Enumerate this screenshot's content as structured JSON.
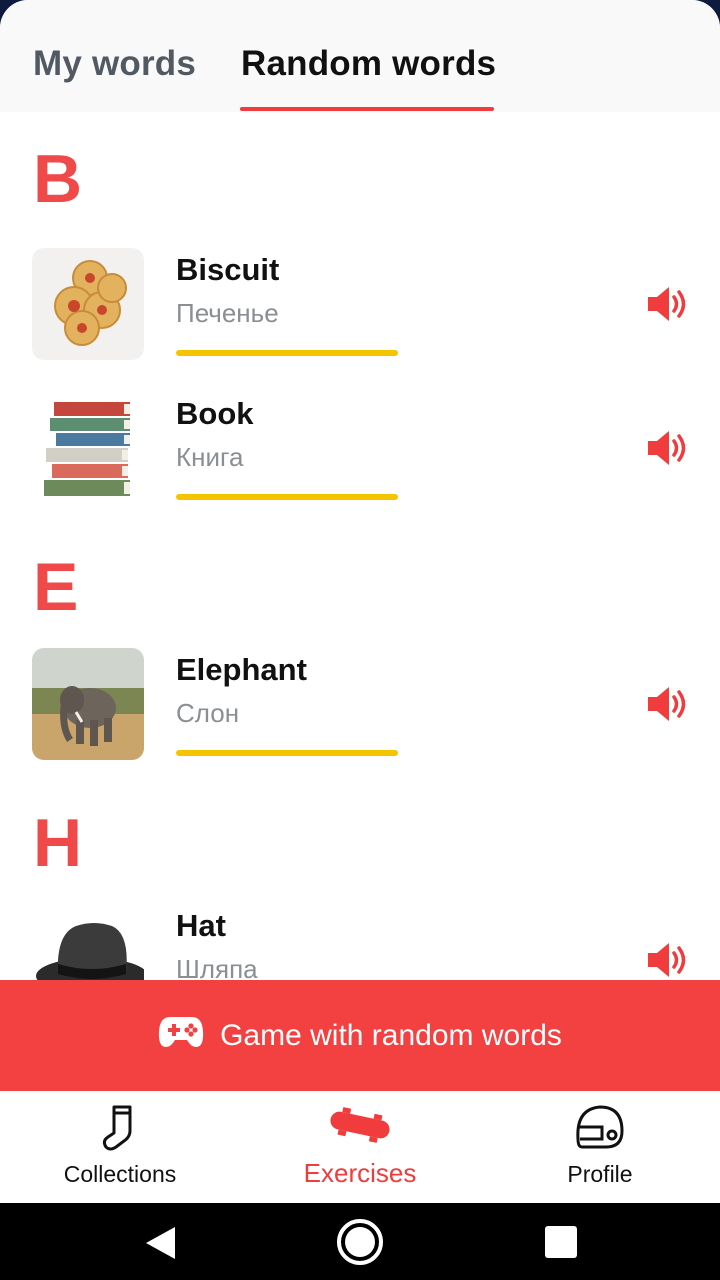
{
  "tabs": {
    "my_words": "My words",
    "random_words": "Random words"
  },
  "sections": [
    {
      "letter": "B",
      "words": [
        {
          "en": "Biscuit",
          "ru": "Печенье",
          "progress": 1.0,
          "image": "biscuit-photo"
        },
        {
          "en": "Book",
          "ru": "Книга",
          "progress": 1.0,
          "image": "books-photo"
        }
      ]
    },
    {
      "letter": "E",
      "words": [
        {
          "en": "Elephant",
          "ru": "Слон",
          "progress": 1.0,
          "image": "elephant-photo"
        }
      ]
    },
    {
      "letter": "H",
      "words": [
        {
          "en": "Hat",
          "ru": "Шляпа",
          "image": "hat-photo"
        }
      ]
    }
  ],
  "cta": {
    "label": "Game with random words",
    "icon": "gamepad-icon"
  },
  "bottom_nav": {
    "collections": "Collections",
    "exercises": "Exercises",
    "profile": "Profile"
  },
  "colors": {
    "accent": "#f03c3c",
    "progress": "#f5c400",
    "letter": "#f04949"
  }
}
